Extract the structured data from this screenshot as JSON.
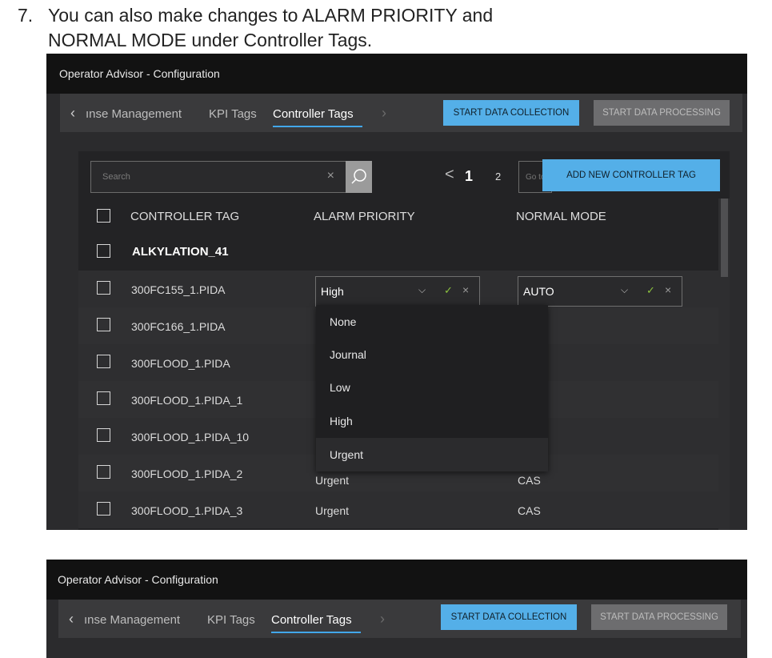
{
  "step": {
    "number": "7.",
    "line1": "You can also make changes to ALARM PRIORITY and",
    "line2": "NORMAL MODE under Controller Tags."
  },
  "window": {
    "title": "Operator Advisor - Configuration"
  },
  "tabs": [
    {
      "label": "ınse Management",
      "active": false
    },
    {
      "label": "KPI Tags",
      "active": false
    },
    {
      "label": "Controller Tags",
      "active": true
    }
  ],
  "toolbar": {
    "start_data_collection": "START DATA COLLECTION",
    "start_data_processing": "START DATA PROCESSING"
  },
  "search": {
    "placeholder": "Search",
    "clear": "×"
  },
  "pagination": {
    "prev": "<",
    "current": "1",
    "next_page": "2",
    "goto_placeholder": "Go to"
  },
  "add_button": "ADD NEW CONTROLLER TAG",
  "table": {
    "columns": [
      "CONTROLLER TAG",
      "ALARM PRIORITY",
      "NORMAL MODE"
    ],
    "group": "ALKYLATION_41",
    "rows": [
      {
        "tag": "300FC155_1.PIDA",
        "priority": "High",
        "mode": "AUTO"
      },
      {
        "tag": "300FC166_1.PIDA",
        "priority": "",
        "mode": ""
      },
      {
        "tag": "300FLOOD_1.PIDA",
        "priority": "",
        "mode": ""
      },
      {
        "tag": "300FLOOD_1.PIDA_1",
        "priority": "",
        "mode": ""
      },
      {
        "tag": "300FLOOD_1.PIDA_10",
        "priority": "",
        "mode": ""
      },
      {
        "tag": "300FLOOD_1.PIDA_2",
        "priority": "Urgent",
        "mode": "CAS"
      },
      {
        "tag": "300FLOOD_1.PIDA_3",
        "priority": "Urgent",
        "mode": "CAS"
      }
    ]
  },
  "editors": {
    "priority": {
      "value": "High",
      "dropdown_icon": "chevron-down-icon",
      "confirm_icon": "check-icon",
      "cancel_icon": "close-icon"
    },
    "mode": {
      "value": "AUTO"
    }
  },
  "dropdown_options": [
    "None",
    "Journal",
    "Low",
    "High",
    "Urgent"
  ],
  "colors": {
    "accent": "#54afe8",
    "confirm": "#8cc23f",
    "background": "#2b2b2d"
  }
}
